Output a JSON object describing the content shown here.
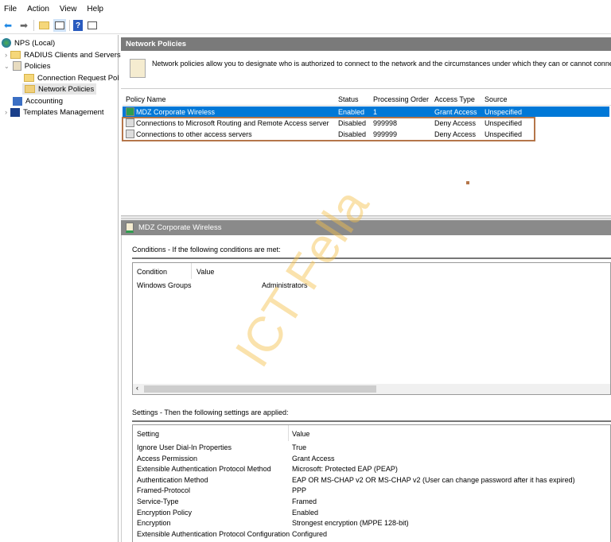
{
  "menu": [
    "File",
    "Action",
    "View",
    "Help"
  ],
  "tree": {
    "root": "NPS (Local)",
    "items": [
      "RADIUS Clients and Servers",
      "Policies",
      "Connection Request Pol",
      "Network Policies",
      "Accounting",
      "Templates Management"
    ]
  },
  "pane": {
    "title": "Network Policies",
    "info": "Network policies allow you to designate who is authorized to connect to the network and the circumstances under which they can or cannot connect."
  },
  "table": {
    "headers": [
      "Policy Name",
      "Status",
      "Processing Order",
      "Access Type",
      "Source"
    ],
    "rows": [
      [
        "MDZ Corporate Wireless",
        "Enabled",
        "1",
        "Grant Access",
        "Unspecified"
      ],
      [
        "Connections to Microsoft Routing and Remote Access server",
        "Disabled",
        "999998",
        "Deny Access",
        "Unspecified"
      ],
      [
        "Connections to other access servers",
        "Disabled",
        "999999",
        "Deny Access",
        "Unspecified"
      ]
    ]
  },
  "detail": {
    "title": "MDZ Corporate Wireless",
    "conditions_label": "Conditions - If the following conditions are met:",
    "cond_headers": [
      "Condition",
      "Value"
    ],
    "conditions": [
      [
        "Windows Groups",
        "Administrators"
      ]
    ],
    "settings_label": "Settings - Then the following settings are applied:",
    "set_headers": [
      "Setting",
      "Value"
    ],
    "settings": [
      [
        "Ignore User Dial-In Properties",
        "True"
      ],
      [
        "Access Permission",
        "Grant Access"
      ],
      [
        "Extensible Authentication Protocol Method",
        "Microsoft: Protected EAP (PEAP)"
      ],
      [
        "Authentication Method",
        "EAP OR MS-CHAP v2 OR MS-CHAP v2 (User can change password after it has expired)"
      ],
      [
        "Framed-Protocol",
        "PPP"
      ],
      [
        "Service-Type",
        "Framed"
      ],
      [
        "Encryption Policy",
        "Enabled"
      ],
      [
        "Encryption",
        "Strongest encryption (MPPE 128-bit)"
      ],
      [
        "Extensible Authentication Protocol Configuration",
        "Configured"
      ]
    ]
  },
  "watermark": "ICT Fella",
  "colors": {
    "selection": "#0078d7",
    "highlight_box": "#b5764a",
    "header_bar": "#7a7a7a",
    "watermark": "#f6c04a"
  }
}
